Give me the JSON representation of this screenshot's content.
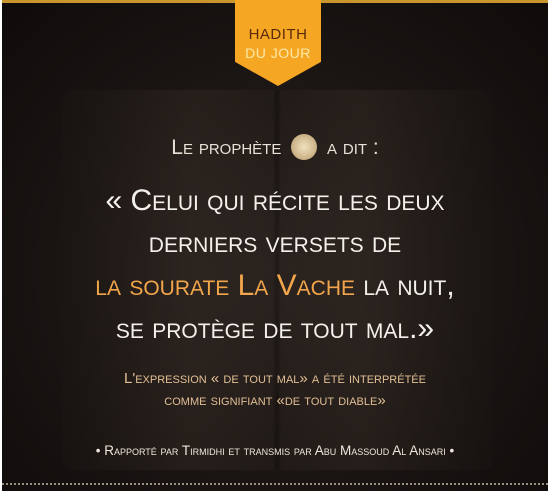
{
  "badge": {
    "line1": "HADITH",
    "line2": "DU JOUR"
  },
  "intro": {
    "before": "Le prophète",
    "after": "a dit :",
    "seal_icon": "arabic-calligraphy-seal"
  },
  "quote": {
    "line1": "« Celui qui récite les deux",
    "line2": "derniers versets de",
    "line3_highlight": "la sourate La Vache",
    "line3_rest": " la nuit,",
    "line4": "se protège de tout mal.»"
  },
  "expression": {
    "line1": "L'expression « de tout mal» a été interprétée",
    "line2": "comme signifiant «de tout diable»"
  },
  "footer": "• Rapporté par Tirmidhi et transmis par Abu Massoud Al Ansari •",
  "colors": {
    "accent": "#f5a623",
    "highlight": "#f2a54a",
    "background": "#1a1513"
  }
}
